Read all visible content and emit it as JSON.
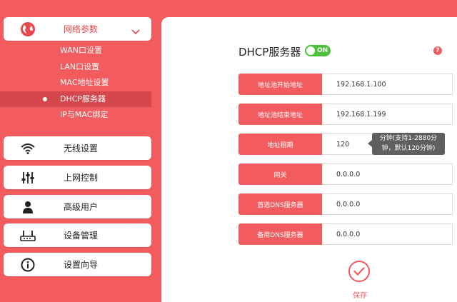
{
  "sidebar": {
    "network_params": {
      "label": "网络参数",
      "submenu": [
        "WAN口设置",
        "LAN口设置",
        "MAC地址设置",
        "DHCP服务器",
        "IP与MAC绑定"
      ],
      "active_index": 3
    },
    "menu_items": [
      {
        "label": "无线设置",
        "icon": "wifi-icon"
      },
      {
        "label": "上网控制",
        "icon": "sliders-icon"
      },
      {
        "label": "高级用户",
        "icon": "user-icon"
      },
      {
        "label": "设备管理",
        "icon": "router-icon"
      },
      {
        "label": "设置向导",
        "icon": "info-icon"
      }
    ]
  },
  "main": {
    "title": "DHCP服务器",
    "toggle": "ON",
    "help": "?",
    "fields": [
      {
        "label": "地址池开始地址",
        "value": "192.168.1.100"
      },
      {
        "label": "地址池结束地址",
        "value": "192.168.1.199"
      },
      {
        "label": "地址租期",
        "value": "120"
      },
      {
        "label": "网关",
        "value": "0.0.0.0"
      },
      {
        "label": "首选DNS服务器",
        "value": "0.0.0.0"
      },
      {
        "label": "备用DNS服务器",
        "value": "0.0.0.0"
      }
    ],
    "lease_tip": "分钟(支持1-2880分钟，默认120分钟)",
    "save_label": "保存"
  },
  "colors": {
    "accent": "#f25c5f",
    "toggle_on": "#4cc03a",
    "tip_bg": "#5f5f5f"
  }
}
